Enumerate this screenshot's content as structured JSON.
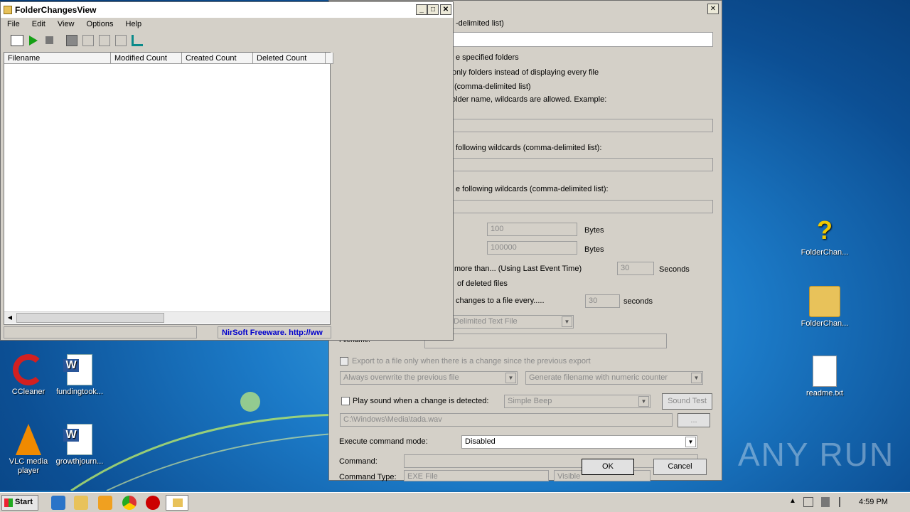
{
  "main_window": {
    "title": "FolderChangesView",
    "menu": [
      "File",
      "Edit",
      "View",
      "Options",
      "Help"
    ],
    "columns": [
      "Filename",
      "Modified Count",
      "Created Count",
      "Deleted Count"
    ],
    "status_text": "NirSoft Freeware.  http://ww"
  },
  "options_dialog": {
    "text_lines": [
      "-delimited list)",
      "e specified folders",
      "only folders instead of displaying every file",
      "(comma-delimited list)",
      "older name, wildcards are allowed. Example:",
      "following wildcards (comma-delimited list):",
      "e following wildcards (comma-delimited list):"
    ],
    "size_min": "100",
    "size_max": "100000",
    "bytes_label": "Bytes",
    "last_event_text": "more than... (Using Last Event Time)",
    "seconds_value": "30",
    "seconds_label": "Seconds",
    "deleted_text": "of deleted files",
    "changes_text": "changes to a file every.....",
    "changes_value": "30",
    "changes_unit": "seconds",
    "export_format": "Delimited Text File",
    "filename_label": "Filename:",
    "export_only_change": "Export to a file only when there is a change since the previous export",
    "overwrite_option": "Always overwrite the previous file",
    "filename_counter": "Generate filename with numeric counter",
    "play_sound_label": "Play sound when a change is detected:",
    "sound_type": "Simple Beep",
    "sound_test": "Sound Test",
    "sound_file": "C:\\Windows\\Media\\tada.wav",
    "browse": "...",
    "exec_mode_label": "Execute command mode:",
    "exec_mode_value": "Disabled",
    "command_label": "Command:",
    "command_type_label": "Command Type:",
    "command_type_value": "EXE File",
    "window_mode": "Visible",
    "ok": "OK",
    "cancel": "Cancel"
  },
  "desktop_icons": [
    {
      "label": "CCleaner"
    },
    {
      "label": "fundingtook..."
    },
    {
      "label": "VLC media player"
    },
    {
      "label": "growthjourn..."
    },
    {
      "label": "FolderChan..."
    },
    {
      "label": "FolderChan..."
    },
    {
      "label": "readme.txt"
    }
  ],
  "taskbar": {
    "start": "Start",
    "clock": "4:59 PM"
  },
  "watermark": "ANY RUN",
  "colors": {
    "dialog_bg": "#d4d0c8",
    "status_link": "#0000cc"
  }
}
